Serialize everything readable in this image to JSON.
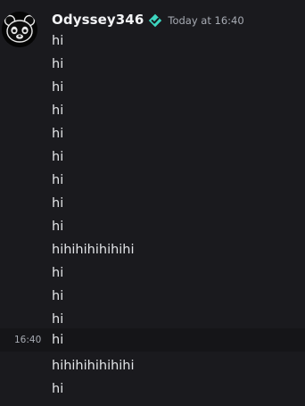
{
  "message": {
    "username": "Odyssey346",
    "timestamp": "Today at 16:40",
    "avatar_icon": "bear-avatar-icon",
    "badge_icon": "verified-badge-icon",
    "badge_color": "#3dd6c0",
    "lines": [
      {
        "text": "hi"
      },
      {
        "text": "hi"
      },
      {
        "text": "hi"
      },
      {
        "text": "hi"
      },
      {
        "text": "hi"
      },
      {
        "text": "hi"
      },
      {
        "text": "hi"
      },
      {
        "text": "hi"
      },
      {
        "text": "hi"
      },
      {
        "text": "hihihihihihihi"
      },
      {
        "text": "hi"
      },
      {
        "text": "hi"
      },
      {
        "text": "hi"
      },
      {
        "text": "hi",
        "hover_time": "16:40"
      },
      {
        "text": "hihihihihihihi"
      },
      {
        "text": "hi"
      }
    ]
  }
}
